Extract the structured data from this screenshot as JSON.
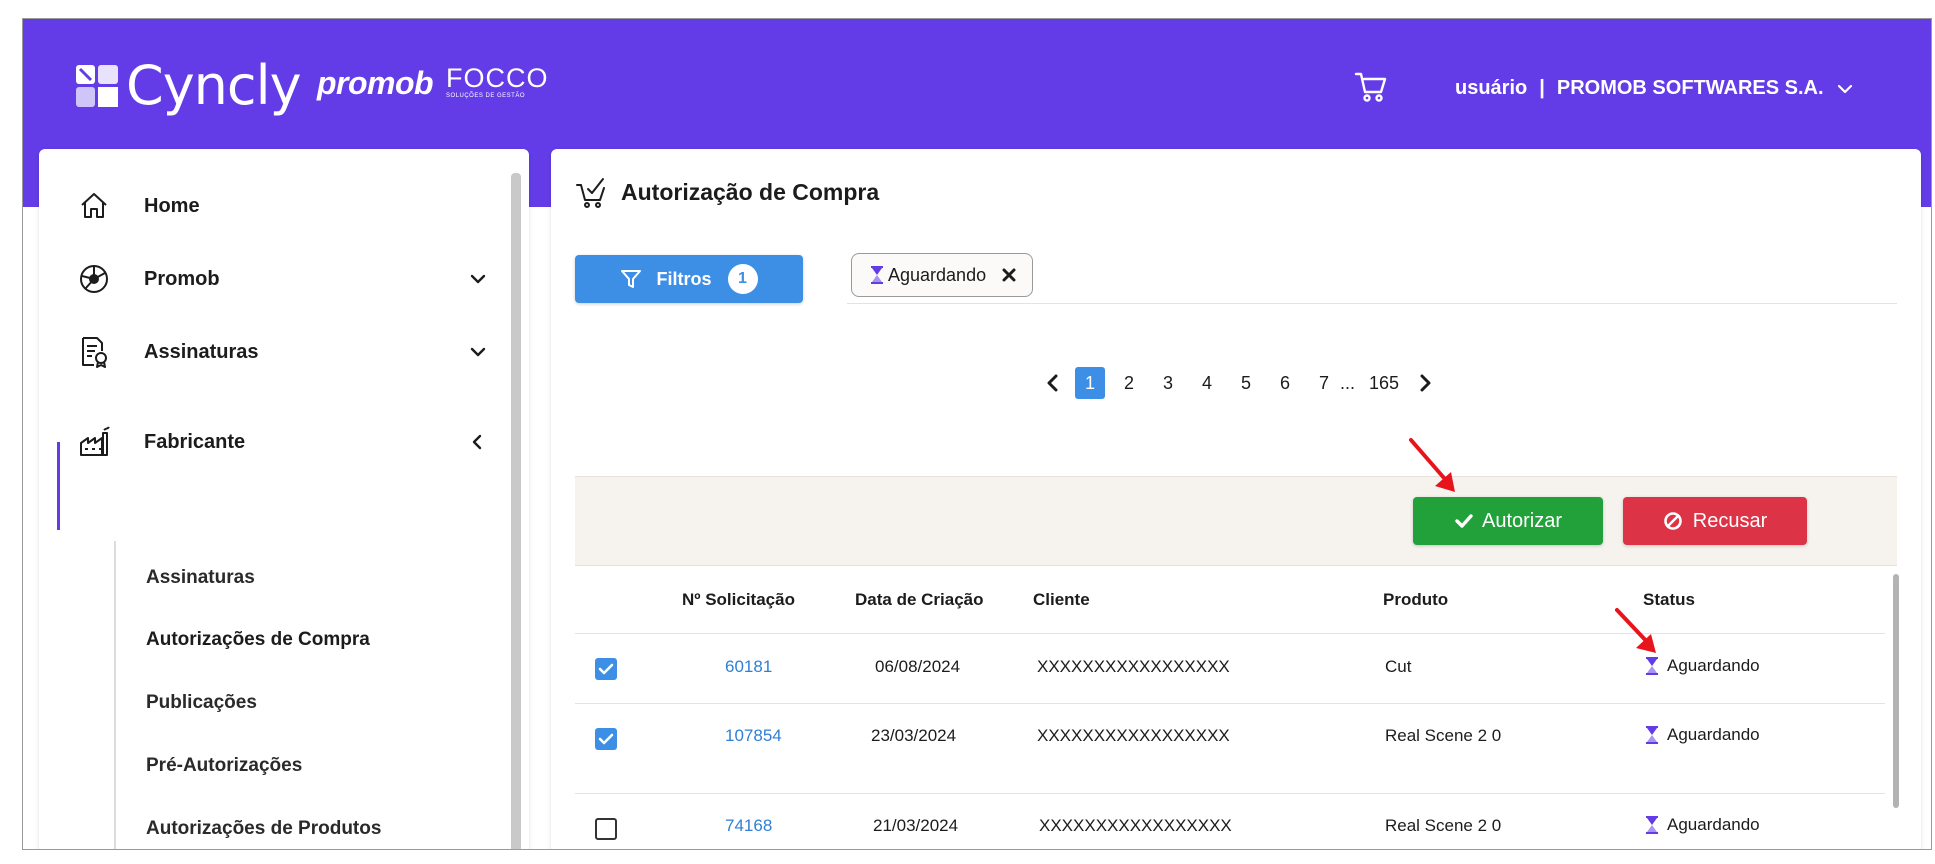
{
  "brand": {
    "logo_name": "Cyncly",
    "promob": "promob",
    "focco": "FOCCO",
    "focco_tagline": "SOLUÇÕES DE GESTÃO"
  },
  "header": {
    "user": "usuário",
    "separator": "|",
    "company": "PROMOB SOFTWARES S.A."
  },
  "sidebar": {
    "items": [
      {
        "label": "Home",
        "icon": "home-icon"
      },
      {
        "label": "Promob",
        "icon": "promob-icon"
      },
      {
        "label": "Assinaturas",
        "icon": "document-badge-icon"
      },
      {
        "label": "Fabricante",
        "icon": "factory-icon"
      }
    ],
    "subitems": [
      "Assinaturas",
      "Autorizações de Compra",
      "Publicações",
      "Pré-Autorizações",
      "Autorizações de Produtos"
    ]
  },
  "page": {
    "title": "Autorização de Compra"
  },
  "filters": {
    "button_label": "Filtros",
    "count": "1",
    "chip_label": "Aguardando"
  },
  "pager": {
    "pages": [
      "1",
      "2",
      "3",
      "4",
      "5",
      "6",
      "7"
    ],
    "active": "1",
    "ellipsis": "...",
    "last": "165"
  },
  "actions": {
    "authorize": "Autorizar",
    "refuse": "Recusar"
  },
  "table": {
    "columns": [
      "Nº Solicitação",
      "Data de Criação",
      "Cliente",
      "Produto",
      "Status"
    ],
    "rows": [
      {
        "checked": true,
        "id": "60181",
        "date": "06/08/2024",
        "client": "XXXXXXXXXXXXXXXXX",
        "product": "Cut",
        "status": "Aguardando"
      },
      {
        "checked": true,
        "id": "107854",
        "date": "23/03/2024",
        "client": "XXXXXXXXXXXXXXXXX",
        "product": "Real Scene 2 0",
        "status": "Aguardando"
      },
      {
        "checked": false,
        "id": "74168",
        "date": "21/03/2024",
        "client": "XXXXXXXXXXXXXXXXX",
        "product": "Real Scene 2 0",
        "status": "Aguardando"
      }
    ]
  },
  "colors": {
    "brand_purple": "#633ce8",
    "primary_blue": "#3d8fe6",
    "success_green": "#22a13a",
    "danger_red": "#dc3346",
    "annotation_red": "#e8141c"
  }
}
